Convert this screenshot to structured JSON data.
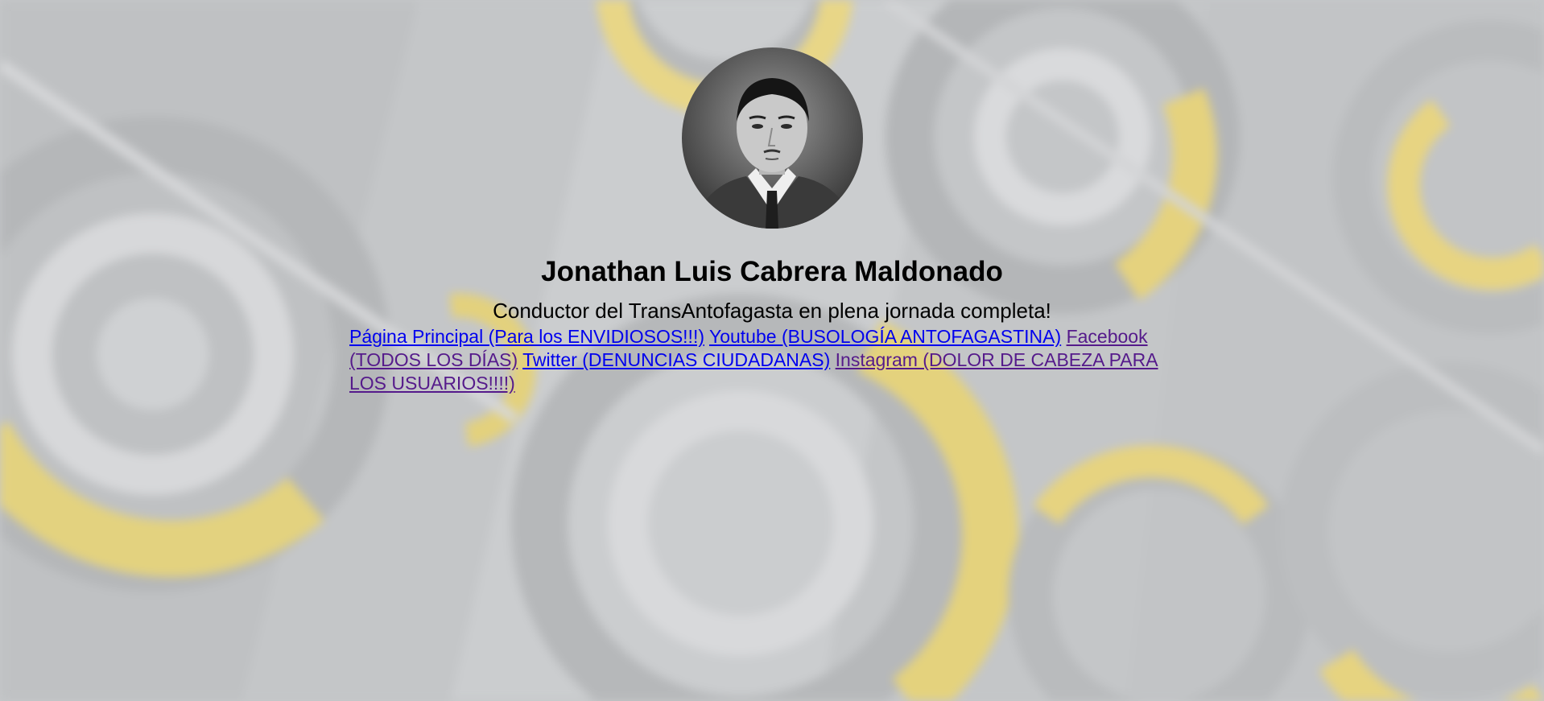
{
  "profile": {
    "name": "Jonathan Luis Cabrera Maldonado",
    "tagline": "Conductor del TransAntofagasta en plena jornada completa!",
    "avatar_icon": "profile-photo"
  },
  "links": [
    {
      "label": "Página Principal (Para los ENVIDIOSOS!!!)",
      "visited": false
    },
    {
      "label": "Youtube (BUSOLOGÍA ANTOFAGASTINA)",
      "visited": false
    },
    {
      "label": "Facebook (TODOS LOS DÍAS)",
      "visited": true
    },
    {
      "label": "Twitter (DENUNCIAS CIUDADANAS)",
      "visited": false
    },
    {
      "label": "Instagram (DOLOR DE CABEZA PARA LOS USUARIOS!!!!)",
      "visited": true
    }
  ],
  "colors": {
    "background": "#c6c8ca",
    "accent_yellow": "#e6d27a",
    "link_unvisited": "#0000ee",
    "link_visited": "#551a8b"
  }
}
